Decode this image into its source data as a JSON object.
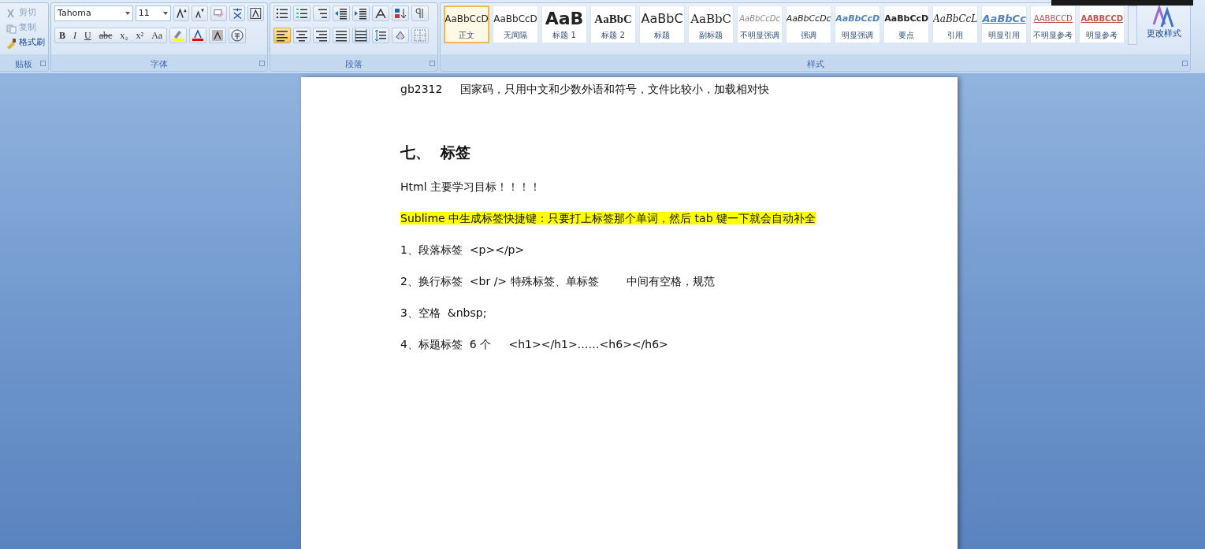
{
  "ribbon": {
    "clipboard": {
      "label": "贴板",
      "items": [
        {
          "label": "剪切",
          "disabled": true
        },
        {
          "label": "复制",
          "disabled": true
        },
        {
          "label": "格式刷",
          "disabled": false
        }
      ]
    },
    "font": {
      "label": "字体",
      "font_name": "Tahoma",
      "font_size": "11",
      "style_buttons": [
        "B",
        "I",
        "U",
        "abc",
        "x₂",
        "x²",
        "Aa"
      ]
    },
    "paragraph": {
      "label": "段落",
      "alignment_buttons": [
        {
          "selected": true
        },
        {
          "selected": false
        },
        {
          "selected": false
        },
        {
          "selected": false
        },
        {
          "selected": false
        }
      ]
    },
    "styles": {
      "label": "样式",
      "change_styles": "更改样式",
      "items": [
        {
          "preview": "AaBbCcD",
          "name": "正文",
          "selected": true
        },
        {
          "preview": "AaBbCcD",
          "name": "无间隔",
          "selected": false
        },
        {
          "preview": "AaB",
          "name": "标题 1",
          "selected": false
        },
        {
          "preview": "AaBbC",
          "name": "标题 2",
          "selected": false
        },
        {
          "preview": "AaBbC",
          "name": "标题",
          "selected": false
        },
        {
          "preview": "AaBbC",
          "name": "副标题",
          "selected": false
        },
        {
          "preview": "AaBbCcDc",
          "name": "不明显强调",
          "selected": false
        },
        {
          "preview": "AaBbCcDc",
          "name": "强调",
          "selected": false
        },
        {
          "preview": "AaBbCcD",
          "name": "明显强调",
          "selected": false
        },
        {
          "preview": "AaBbCcD",
          "name": "要点",
          "selected": false
        },
        {
          "preview": "AaBbCcL",
          "name": "引用",
          "selected": false
        },
        {
          "preview": "AaBbCc",
          "name": "明显引用",
          "selected": false
        },
        {
          "preview": "AABBCCD",
          "name": "不明显参考",
          "selected": false
        },
        {
          "preview": "AABBCCD",
          "name": "明显参考",
          "selected": false
        }
      ]
    }
  },
  "document": {
    "lines": [
      {
        "kind": "text",
        "text": "gb2312     国家码，只用中文和少数外语和符号，文件比较小，加载相对快"
      },
      {
        "kind": "heading",
        "text": "七、  标签"
      },
      {
        "kind": "text",
        "text": "Html 主要学习目标！！！！"
      },
      {
        "kind": "highlight",
        "text": "Sublime 中生成标签快捷键：只要打上标签那个单词，然后 tab 键一下就会自动补全"
      },
      {
        "kind": "text",
        "text": "1、段落标签  <p></p>"
      },
      {
        "kind": "text",
        "text": "2、换行标签  <br /> 特殊标签、单标签        中间有空格，规范"
      },
      {
        "kind": "text",
        "text": "3、空格  &nbsp;"
      },
      {
        "kind": "text",
        "text": "4、标题标签  6 个     <h1></h1>……<h6></h6>"
      }
    ]
  }
}
